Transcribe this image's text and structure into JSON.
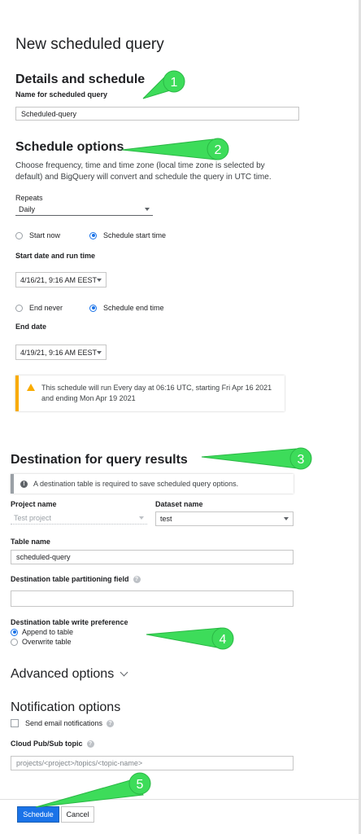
{
  "page_title": "New scheduled query",
  "details": {
    "heading": "Details and schedule",
    "name_label": "Name for scheduled query",
    "name_value": "Scheduled-query"
  },
  "schedule": {
    "heading": "Schedule options",
    "description_line1": "Choose frequency, time and time zone (local time zone is selected by",
    "description_line2": "default) and BigQuery will convert and schedule the query in UTC time.",
    "repeats_label": "Repeats",
    "repeats_value": "Daily",
    "start_now": "Start now",
    "schedule_start_time": "Schedule start time",
    "start_label": "Start date and run time",
    "start_value": "4/16/21, 9:16 AM EEST",
    "end_never": "End never",
    "schedule_end_time": "Schedule end time",
    "end_label": "End date",
    "end_value": "4/19/21, 9:16 AM EEST",
    "notice_line1": "This schedule will run Every day at 06:16 UTC, starting Fri Apr 16 2021",
    "notice_line2": "and ending Mon Apr 19 2021"
  },
  "destination": {
    "heading": "Destination for query results",
    "info": "A destination table is required to save scheduled query options.",
    "project_label": "Project name",
    "project_value": "Test project",
    "dataset_label": "Dataset name",
    "dataset_value": "test",
    "table_label": "Table name",
    "table_value": "scheduled-query",
    "partition_label": "Destination table partitioning field",
    "partition_value": "",
    "write_pref_label": "Destination table write preference",
    "append": "Append to table",
    "overwrite": "Overwrite table"
  },
  "advanced": {
    "heading": "Advanced options"
  },
  "notification": {
    "heading": "Notification options",
    "email": "Send email notifications",
    "pubsub_label": "Cloud Pub/Sub topic",
    "pubsub_placeholder": "projects/<project>/topics/<topic-name>"
  },
  "footer": {
    "schedule_button": "Schedule",
    "cancel_button": "Cancel"
  },
  "annotations": [
    "1",
    "2",
    "3",
    "4",
    "5"
  ],
  "colors": {
    "accent": "#1a73e8",
    "warning": "#f9ab00",
    "annotation": "#3ddc5a"
  }
}
